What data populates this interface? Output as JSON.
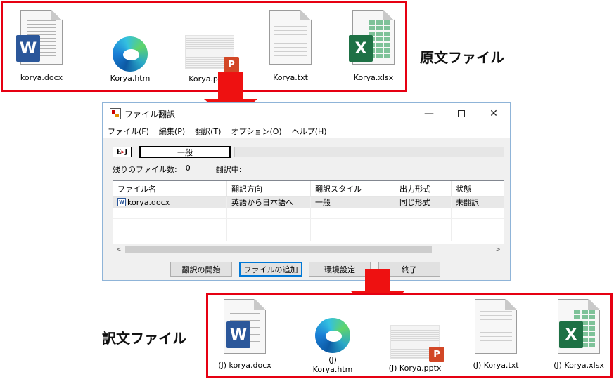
{
  "source_section": {
    "label": "原文ファイル",
    "files": [
      {
        "name": "korya.docx",
        "type": "word",
        "icon": "word-document-icon"
      },
      {
        "name": "Korya.htm",
        "type": "edge",
        "icon": "edge-browser-icon"
      },
      {
        "name": "Korya.pptx",
        "type": "powerpoint",
        "icon": "powerpoint-icon"
      },
      {
        "name": "Korya.txt",
        "type": "text",
        "icon": "text-document-icon"
      },
      {
        "name": "Korya.xlsx",
        "type": "excel",
        "icon": "excel-document-icon"
      }
    ]
  },
  "window": {
    "title": "ファイル翻訳",
    "menu": [
      "ファイル(F)",
      "編集(P)",
      "翻訳(T)",
      "オプション(O)",
      "ヘルプ(H)"
    ],
    "ej_badge": {
      "e": "E",
      "sep": "▸",
      "j": "J"
    },
    "style": "一般",
    "remaining_label": "残りのファイル数:",
    "remaining_count": "0",
    "translating_label": "翻訳中:",
    "columns": [
      "ファイル名",
      "翻訳方向",
      "翻訳スタイル",
      "出力形式",
      "状態"
    ],
    "rows": [
      {
        "file": "korya.docx",
        "direction": "英語から日本語へ",
        "style": "一般",
        "format": "同じ形式",
        "status": "未翻訳"
      }
    ],
    "buttons": {
      "start": "翻訳の開始",
      "add": "ファイルの追加",
      "settings": "環境設定",
      "exit": "終了"
    },
    "scroll_left": "<",
    "scroll_right": ">",
    "controls": {
      "minimize": "—",
      "close": "✕"
    }
  },
  "output_section": {
    "label": "訳文ファイル",
    "files": [
      {
        "name": "(J) korya.docx",
        "type": "word",
        "icon": "word-document-icon"
      },
      {
        "name": "(J)\nKorya.htm",
        "type": "edge",
        "icon": "edge-browser-icon"
      },
      {
        "name": "(J) Korya.pptx",
        "type": "powerpoint",
        "icon": "powerpoint-icon"
      },
      {
        "name": "(J) Korya.txt",
        "type": "text",
        "icon": "text-document-icon"
      },
      {
        "name": "(J) Korya.xlsx",
        "type": "excel",
        "icon": "excel-document-icon"
      }
    ]
  },
  "colors": {
    "frame": "#e60012",
    "arrow": "#ee1111",
    "word": "#2b579a",
    "excel": "#1e7145",
    "powerpoint": "#d24726"
  }
}
